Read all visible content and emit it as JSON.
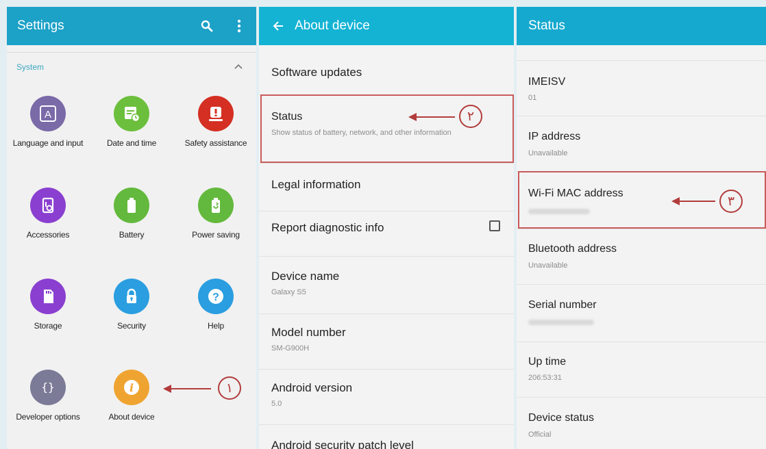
{
  "settings": {
    "title": "Settings",
    "section_label": "System",
    "items": [
      {
        "label": "Language and input",
        "icon": "language-icon",
        "color": "#7a6aa8"
      },
      {
        "label": "Date and time",
        "icon": "calendar-icon",
        "color": "#6cbf3c"
      },
      {
        "label": "Safety assistance",
        "icon": "alert-icon",
        "color": "#d42f22"
      },
      {
        "label": "Accessories",
        "icon": "accessories-icon",
        "color": "#8b3fd0"
      },
      {
        "label": "Battery",
        "icon": "battery-icon",
        "color": "#63b93d"
      },
      {
        "label": "Power saving",
        "icon": "power-saving-icon",
        "color": "#63b93d"
      },
      {
        "label": "Storage",
        "icon": "storage-icon",
        "color": "#8b3fd0"
      },
      {
        "label": "Security",
        "icon": "lock-icon",
        "color": "#2a9ee0"
      },
      {
        "label": "Help",
        "icon": "help-icon",
        "color": "#2a9ee0"
      },
      {
        "label": "Developer options",
        "icon": "braces-icon",
        "color": "#7b7a97"
      },
      {
        "label": "About device",
        "icon": "info-icon",
        "color": "#efa431"
      }
    ]
  },
  "about": {
    "title": "About device",
    "rows": [
      {
        "title": "Software updates"
      },
      {
        "title": "Status",
        "subtitle": "Show status of battery, network, and other information"
      },
      {
        "title": "Legal information"
      },
      {
        "title": "Report diagnostic info"
      },
      {
        "title": "Device name",
        "subtitle": "Galaxy S5"
      },
      {
        "title": "Model number",
        "subtitle": "SM-G900H"
      },
      {
        "title": "Android version",
        "subtitle": "5.0"
      },
      {
        "title": "Android security patch level"
      }
    ]
  },
  "status": {
    "title": "Status",
    "rows": [
      {
        "title": "IMEISV",
        "value": "01"
      },
      {
        "title": "IP address",
        "value": "Unavailable"
      },
      {
        "title": "Wi-Fi MAC address"
      },
      {
        "title": "Bluetooth address",
        "value": "Unavailable"
      },
      {
        "title": "Serial number"
      },
      {
        "title": "Up time",
        "value": "206:53:31"
      },
      {
        "title": "Device status",
        "value": "Official"
      }
    ]
  },
  "callouts": {
    "one": "١",
    "two": "٢",
    "three": "٣"
  },
  "colors": {
    "bar": "#1ca1c7",
    "annotation": "#b23b3b"
  }
}
